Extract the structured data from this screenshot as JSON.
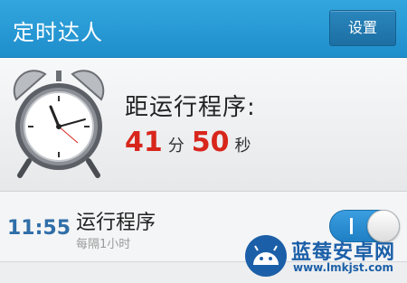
{
  "header": {
    "title": "定时达人",
    "settings_label": "设置"
  },
  "countdown": {
    "label": "距运行程序:",
    "minutes": "41",
    "minutes_unit": "分",
    "seconds": "50",
    "seconds_unit": "秒",
    "clock_icon": "alarm-clock-icon"
  },
  "schedule": {
    "time": "11:55",
    "title": "运行程序",
    "subtitle": "每隔1小时",
    "enabled": true
  },
  "watermark": {
    "brand": "蓝莓安卓网",
    "url": "www.lmkjst.com"
  },
  "colors": {
    "header_blue": "#1f8ecc",
    "accent_red": "#d8261c",
    "time_blue": "#2f6ea8",
    "toggle_blue": "#1f7fc4"
  }
}
